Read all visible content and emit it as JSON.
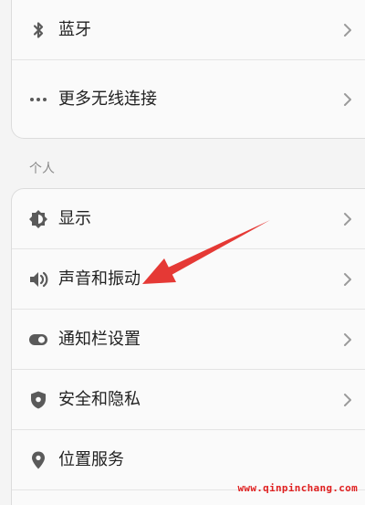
{
  "connectivity": {
    "items": [
      {
        "label": "蓝牙",
        "icon": "bluetooth-icon"
      },
      {
        "label": "更多无线连接",
        "icon": "more-dots-icon"
      }
    ]
  },
  "personal": {
    "section_label": "个人",
    "items": [
      {
        "label": "显示",
        "icon": "display-icon"
      },
      {
        "label": "声音和振动",
        "icon": "sound-icon"
      },
      {
        "label": "通知栏设置",
        "icon": "notification-toggle-icon"
      },
      {
        "label": "安全和隐私",
        "icon": "shield-icon"
      },
      {
        "label": "位置服务",
        "icon": "location-pin-icon"
      }
    ]
  },
  "annotation": {
    "arrow_color": "#e53935",
    "target": "声音和振动"
  },
  "watermark": {
    "text": "www.qinpinchang.com",
    "color": "#e02020"
  },
  "colors": {
    "background": "#f4f4f4",
    "card": "#fafafa",
    "text": "#222222",
    "icon": "#5a5a5a",
    "chevron": "#9a9a9a",
    "section_label": "#8a8a8a"
  }
}
